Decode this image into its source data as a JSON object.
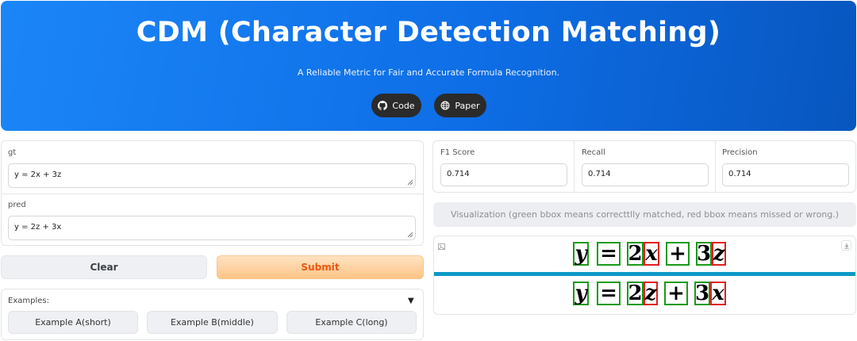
{
  "header": {
    "title": "CDM (Character Detection Matching)",
    "subtitle": "A Reliable Metric for Fair and Accurate Formula Recognition.",
    "code_label": "Code",
    "paper_label": "Paper"
  },
  "inputs": {
    "gt_label": "gt",
    "gt_value": "y = 2x + 3z",
    "pred_label": "pred",
    "pred_value": "y = 2z + 3x"
  },
  "actions": {
    "clear_label": "Clear",
    "submit_label": "Submit"
  },
  "examples": {
    "label": "Examples:",
    "items": [
      "Example A(short)",
      "Example B(middle)",
      "Example C(long)"
    ]
  },
  "metrics": {
    "f1_label": "F1 Score",
    "f1_value": "0.714",
    "recall_label": "Recall",
    "recall_value": "0.714",
    "precision_label": "Precision",
    "precision_value": "0.714"
  },
  "visualization": {
    "title": "Visualization (green bbox means correcttlly matched, red bbox means missed or wrong.)",
    "gt_tokens": [
      {
        "char": "y",
        "italic": true,
        "status": "matched"
      },
      {
        "char": "=",
        "italic": false,
        "status": "matched"
      },
      {
        "char": "2",
        "italic": false,
        "status": "matched"
      },
      {
        "char": "x",
        "italic": true,
        "status": "wrong"
      },
      {
        "char": "+",
        "italic": false,
        "status": "matched"
      },
      {
        "char": "3",
        "italic": false,
        "status": "matched"
      },
      {
        "char": "z",
        "italic": true,
        "status": "wrong"
      }
    ],
    "pred_tokens": [
      {
        "char": "y",
        "italic": true,
        "status": "matched"
      },
      {
        "char": "=",
        "italic": false,
        "status": "matched"
      },
      {
        "char": "2",
        "italic": false,
        "status": "matched"
      },
      {
        "char": "z",
        "italic": true,
        "status": "wrong"
      },
      {
        "char": "+",
        "italic": false,
        "status": "matched"
      },
      {
        "char": "3",
        "italic": false,
        "status": "matched"
      },
      {
        "char": "x",
        "italic": true,
        "status": "wrong"
      }
    ],
    "colors": {
      "matched": "#1a9a1a",
      "wrong": "#e01f1f",
      "divider": "#0d99c6"
    }
  }
}
